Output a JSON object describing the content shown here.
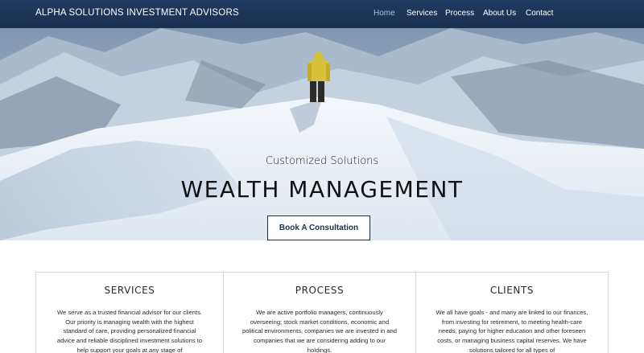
{
  "header": {
    "brand": "ALPHA SOLUTIONS INVESTMENT ADVISORS",
    "nav": [
      "Home",
      "Services",
      "Process",
      "About Us",
      "Contact"
    ],
    "active_nav": "Home",
    "background_color": "#1e3a5f"
  },
  "hero": {
    "subtitle": "Customized Solutions",
    "title": "WEALTH  MANAGEMENT",
    "cta_label": "Book A Consultation"
  },
  "cards": [
    {
      "title": "SERVICES",
      "body": "We serve as a trusted financial advisor for our clients.  Our priority is managing wealth with the highest standard of care, providing personalized financial advice and reliable disciplined investment solutions to help support your goals at any stage of"
    },
    {
      "title": "PROCESS",
      "body": "We are active portfolio managers, continuously overseeing; stock market conditions, economic and political environments, companies we are invested in and companies that we are considering adding to our holdings."
    },
    {
      "title": "CLIENTS",
      "body": "We all have goals - and many are linked to our finances, from investing for retirement, to meeting health-care needs, paying for higher education and other foreseen costs, or managing business capital reserves.  We have solutions tailored for all types of"
    }
  ]
}
